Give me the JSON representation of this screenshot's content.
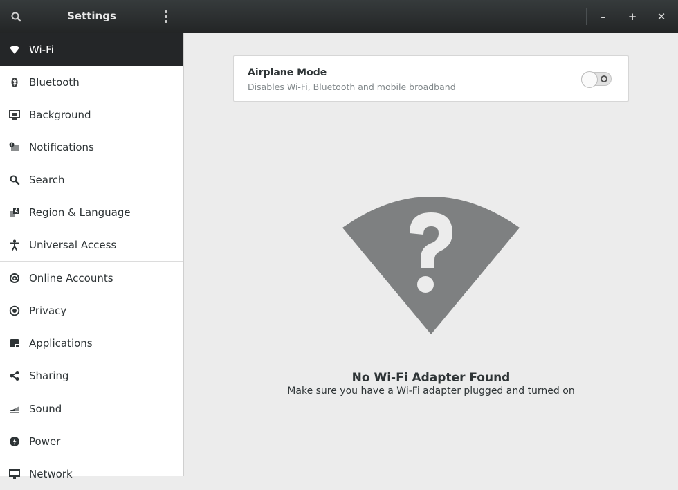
{
  "header": {
    "title": "Settings",
    "window_controls": {
      "minimize": "–",
      "maximize": "+",
      "close": "✕"
    }
  },
  "sidebar": {
    "items": [
      {
        "label": "Wi-Fi",
        "icon": "wifi-icon",
        "selected": true
      },
      {
        "label": "Bluetooth",
        "icon": "bluetooth-icon"
      },
      {
        "label": "Background",
        "icon": "monitor-icon"
      },
      {
        "label": "Notifications",
        "icon": "notification-icon"
      },
      {
        "label": "Search",
        "icon": "search-icon"
      },
      {
        "label": "Region & Language",
        "icon": "region-icon"
      },
      {
        "label": "Universal Access",
        "icon": "accessibility-icon"
      },
      {
        "label": "Online Accounts",
        "icon": "at-sign-icon"
      },
      {
        "label": "Privacy",
        "icon": "privacy-icon"
      },
      {
        "label": "Applications",
        "icon": "applications-icon"
      },
      {
        "label": "Sharing",
        "icon": "share-icon"
      },
      {
        "label": "Sound",
        "icon": "sound-icon"
      },
      {
        "label": "Power",
        "icon": "power-icon"
      },
      {
        "label": "Network",
        "icon": "network-icon"
      }
    ]
  },
  "airplane_mode": {
    "title": "Airplane Mode",
    "subtitle": "Disables Wi-Fi, Bluetooth and mobile broadband",
    "enabled": false
  },
  "empty_state": {
    "icon": "wifi-no-adapter-icon",
    "title": "No Wi-Fi Adapter Found",
    "subtitle": "Make sure you have a Wi-Fi adapter plugged and turned on"
  },
  "colors": {
    "header_bg": "#2b2e2f",
    "sidebar_selected": "#242628",
    "content_bg": "#ececec",
    "icon_gray": "#7e8081"
  }
}
